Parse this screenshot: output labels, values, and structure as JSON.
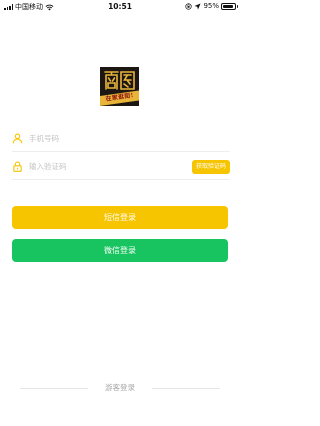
{
  "status_bar": {
    "carrier": "中国移动",
    "time": "10:51",
    "battery_percent": "95%",
    "battery_level": 0.95,
    "icons": [
      "signal-icon",
      "wifi-icon",
      "orientation-lock-icon",
      "location-arrow-icon",
      "battery-icon"
    ]
  },
  "logo": {
    "caption": "在家逛街!"
  },
  "form": {
    "phone": {
      "placeholder": "手机号码",
      "value": "",
      "icon": "user-icon"
    },
    "code": {
      "placeholder": "输入验证码",
      "value": "",
      "icon": "lock-icon",
      "get_code_label": "获取验证码"
    }
  },
  "buttons": {
    "sms_login": "短信登录",
    "wechat_login": "微信登录"
  },
  "guest_login": "游客登录",
  "colors": {
    "accent_yellow": "#f7c400",
    "wechat_green": "#17c45f",
    "logo_background": "#1c1712",
    "logo_band": "#e8b53a"
  }
}
